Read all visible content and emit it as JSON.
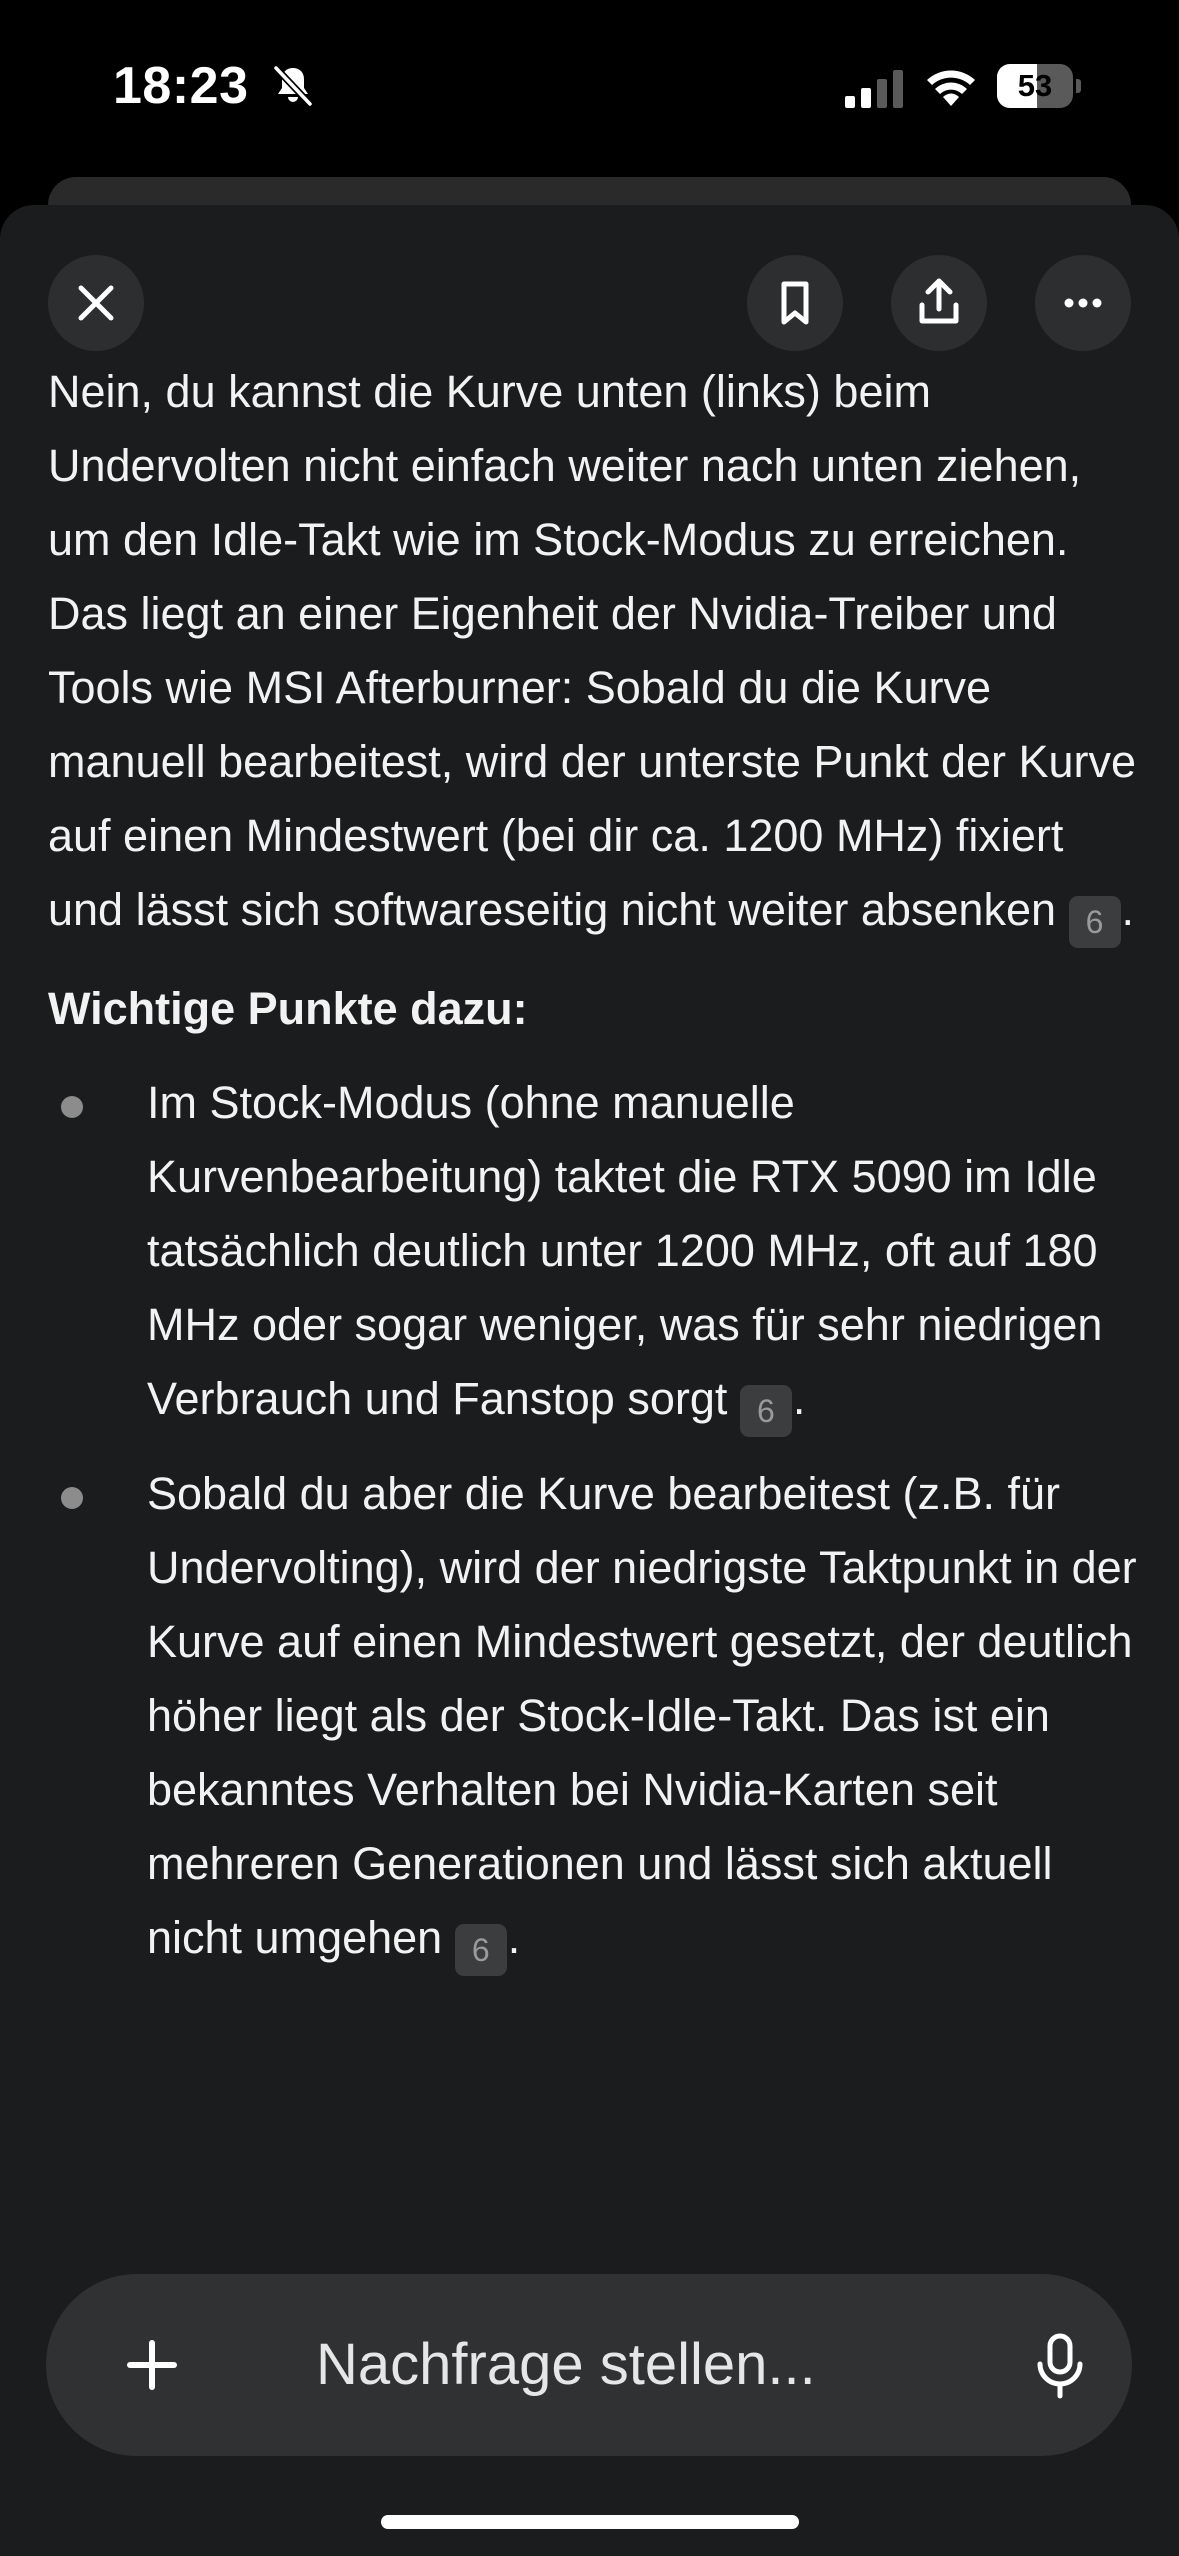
{
  "status_bar": {
    "time": "18:23",
    "battery_level": "53",
    "battery_fraction": 0.53
  },
  "toolbar": {
    "close_icon": "close-icon",
    "bookmark_icon": "bookmark-icon",
    "share_icon": "share-icon",
    "more_icon": "more-icon"
  },
  "answer": {
    "intro": "Nein, du kannst die Kurve unten (links) beim Undervolten nicht einfach weiter nach unten ziehen, um den Idle-Takt wie im Stock-Modus zu erreichen. Das liegt an einer Eigenheit der Nvidia-Treiber und Tools wie MSI Afterburner: Sobald du die Kurve manuell bearbeitest, wird der unterste Punkt der Kurve auf einen Mindestwert (bei dir ca. 1200 MHz) fixiert und lässt sich softwareseitig nicht weiter absenken",
    "intro_citation": "6",
    "heading": "Wichtige Punkte dazu:",
    "bullets": [
      {
        "text": "Im Stock-Modus (ohne manuelle Kurvenbearbeitung) taktet die RTX 5090 im Idle tatsächlich deutlich unter 1200 MHz, oft auf 180 MHz oder sogar weniger, was für sehr niedrigen Verbrauch und Fanstop sorgt",
        "citation": "6"
      },
      {
        "text": "Sobald du aber die Kurve bearbeitest (z.B. für Undervolting), wird der niedrigste Taktpunkt in der Kurve auf einen Mindestwert gesetzt, der deutlich höher liegt als der Stock-Idle-Takt. Das ist ein bekanntes Verhalten bei Nvidia-Karten seit mehreren Generationen und lässt sich aktuell nicht umgehen",
        "citation": "6"
      }
    ]
  },
  "composer": {
    "placeholder": "Nachfrage stellen...",
    "plus_icon": "plus-icon",
    "mic_icon": "microphone-icon"
  },
  "colors": {
    "sheet_background": "#1b1c1d",
    "button_background": "#2d2e30",
    "composer_background": "#303133",
    "text": "#f2f2f2"
  }
}
